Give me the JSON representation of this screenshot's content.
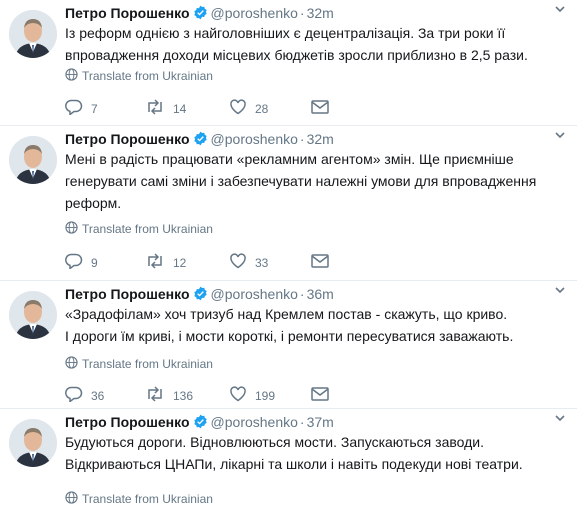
{
  "tweets": [
    {
      "name": "Петро Порошенко",
      "handle": "@poroshenko",
      "separator": "·",
      "time": "32m",
      "lines": [
        "Із реформ однією з найголовніших є децентралізація. За три роки її",
        "впровадження доходи місцевих бюджетів зросли приблизно в 2,5 рази."
      ],
      "translate": "Translate from Ukrainian",
      "replies": "7",
      "retweets": "14",
      "likes": "28"
    },
    {
      "name": "Петро Порошенко",
      "handle": "@poroshenko",
      "separator": "·",
      "time": "32m",
      "lines": [
        "Мені в радість працювати «рекламним агентом» змін. Ще приємніше",
        "генерувати самі зміни і забезпечувати належні умови для впровадження",
        "реформ."
      ],
      "translate": "Translate from Ukrainian",
      "replies": "9",
      "retweets": "12",
      "likes": "33"
    },
    {
      "name": "Петро Порошенко",
      "handle": "@poroshenko",
      "separator": "·",
      "time": "36m",
      "lines": [
        "«Зрадофілам» хоч тризуб над Кремлем постав - скажуть, що криво.",
        "І дороги їм криві, і мости короткі, і ремонти пересуватися заважають."
      ],
      "translate": "Translate from Ukrainian",
      "replies": "36",
      "retweets": "136",
      "likes": "199"
    },
    {
      "name": "Петро Порошенко",
      "handle": "@poroshenko",
      "separator": "·",
      "time": "37m",
      "lines": [
        "Будуються дороги. Відновлюються мости. Запускаються заводи.",
        "Відкриваються ЦНАПи, лікарні та школи і навіть подекуди нові театри."
      ],
      "translate": "Translate from Ukrainian"
    }
  ],
  "icons": {
    "verified": "verified-badge-icon",
    "caret": "chevron-down-icon",
    "globe": "globe-icon",
    "reply": "reply-icon",
    "retweet": "retweet-icon",
    "like": "heart-icon",
    "dm": "envelope-icon"
  },
  "colors": {
    "verified": "#1da1f2",
    "muted": "#657786",
    "divider": "#e6ecf0",
    "text": "#14171a"
  }
}
